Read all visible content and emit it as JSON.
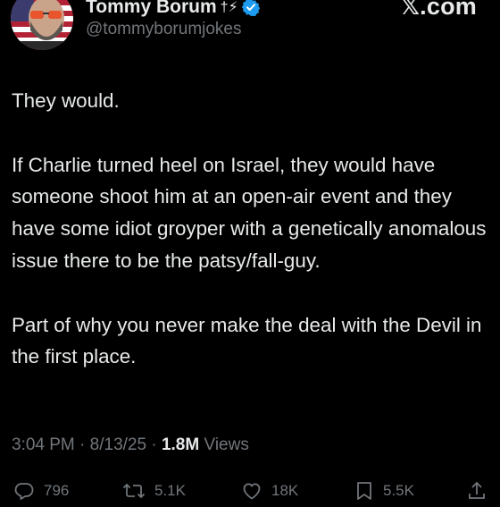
{
  "header": {
    "display_name": "Tommy Borum",
    "name_emoji": "†⚡",
    "handle": "@tommyborumjokes",
    "brand": "𝕏.com",
    "avatar_icon": "avatar-sunglasses-flag",
    "verified_icon": "verified-badge-icon",
    "accent_color": "#1d9bf0"
  },
  "tweet": {
    "paragraphs": [
      "They would.",
      "If Charlie turned heel on Israel, they would have someone shoot him at an open-air event and they have some idiot groyper with a genetically anomalous issue there to be the patsy/fall-guy.",
      "Part of why you never make the deal with the Devil in the first place."
    ]
  },
  "meta": {
    "time": "3:04 PM",
    "date": "8/13/25",
    "views_count": "1.8M",
    "views_label": "Views",
    "separator": "·"
  },
  "actions": {
    "reply": {
      "icon": "reply-icon",
      "count": "796"
    },
    "retweet": {
      "icon": "retweet-icon",
      "count": "5.1K"
    },
    "like": {
      "icon": "heart-icon",
      "count": "18K"
    },
    "bookmark": {
      "icon": "bookmark-icon",
      "count": "5.5K"
    },
    "share": {
      "icon": "share-icon"
    }
  }
}
